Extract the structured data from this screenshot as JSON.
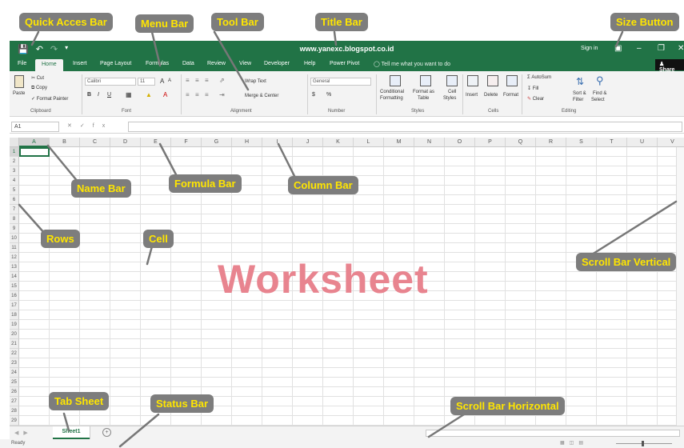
{
  "title_bar": {
    "site_title": "www.yanexc.blogspot.co.id",
    "sign_in": "Sign in",
    "qat_icons": [
      "save-icon",
      "undo-icon",
      "redo-icon",
      "customize-icon"
    ],
    "window_buttons": [
      "ribbon-display-icon",
      "minimize-icon",
      "restore-icon",
      "close-icon"
    ]
  },
  "menu": {
    "tabs": [
      "File",
      "Home",
      "Insert",
      "Page Layout",
      "Formulas",
      "Data",
      "Review",
      "View",
      "Developer",
      "Help",
      "Power Pivot"
    ],
    "active_tab": "Home",
    "tell_me": "Tell me what you want to do",
    "share": "Share"
  },
  "ribbon": {
    "clipboard": {
      "paste": "Paste",
      "cut": "Cut",
      "copy": "Copy",
      "format_painter": "Format Painter",
      "label": "Clipboard"
    },
    "font": {
      "name": "Calibri",
      "size": "11",
      "label": "Font",
      "bold": "B",
      "italic": "I",
      "underline": "U"
    },
    "alignment": {
      "wrap_text": "Wrap Text",
      "merge_center": "Merge & Center",
      "label": "Alignment"
    },
    "number": {
      "format": "General",
      "label": "Number",
      "currency": "$",
      "percent": "%"
    },
    "styles": {
      "conditional": "Conditional",
      "conditional2": "Formatting",
      "format_as": "Format as",
      "format_as2": "Table",
      "cell": "Cell",
      "cell2": "Styles",
      "label": "Styles"
    },
    "cells": {
      "insert": "Insert",
      "delete": "Delete",
      "format": "Format",
      "label": "Cells"
    },
    "editing": {
      "autosum": "AutoSum",
      "fill": "Fill",
      "clear": "Clear",
      "sort": "Sort &",
      "sort2": "Filter",
      "find": "Find &",
      "find2": "Select",
      "label": "Editing"
    }
  },
  "formula_bar": {
    "name_box": "A1",
    "fx": "fx"
  },
  "grid": {
    "columns": [
      "A",
      "B",
      "C",
      "D",
      "E",
      "F",
      "G",
      "H",
      "I",
      "J",
      "K",
      "L",
      "M",
      "N",
      "O",
      "P",
      "Q",
      "R",
      "S",
      "T",
      "U",
      "V"
    ],
    "rows": [
      "1",
      "2",
      "3",
      "4",
      "5",
      "6",
      "7",
      "8",
      "9",
      "10",
      "11",
      "12",
      "13",
      "14",
      "15",
      "16",
      "17",
      "18",
      "19",
      "20",
      "21",
      "22",
      "23",
      "24",
      "25",
      "26",
      "27",
      "28",
      "29"
    ],
    "overlay_text": "Worksheet"
  },
  "sheets": {
    "tabs": [
      "Sheet1"
    ],
    "add": "+"
  },
  "status": {
    "ready": "Ready"
  },
  "callouts": {
    "quick_access": "Quick Acces Bar",
    "menu_bar": "Menu Bar",
    "tool_bar": "Tool Bar",
    "title_bar": "Title Bar",
    "size_button": "Size Button",
    "name_bar": "Name Bar",
    "formula_bar": "Formula Bar",
    "column_bar": "Column Bar",
    "rows": "Rows",
    "cell": "Cell",
    "scroll_vertical": "Scroll Bar Vertical",
    "tab_sheet": "Tab Sheet",
    "status_bar": "Status Bar",
    "scroll_horizontal": "Scroll Bar Horizontal"
  },
  "colors": {
    "excel_green": "#217346",
    "callout_bg": "#7d7d7d",
    "callout_text": "#ffe600",
    "worksheet_text": "#e8848f"
  }
}
